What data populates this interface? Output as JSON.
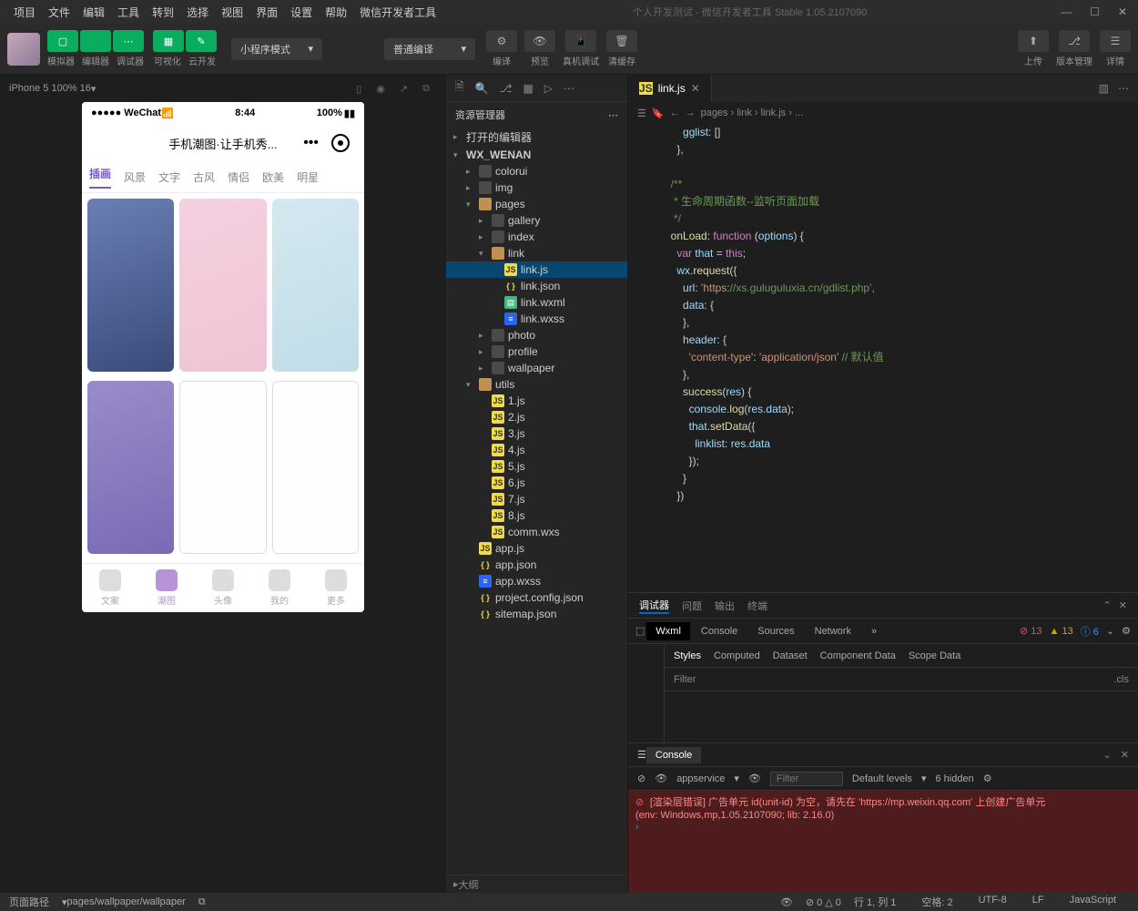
{
  "menubar": [
    "项目",
    "文件",
    "编辑",
    "工具",
    "转到",
    "选择",
    "视图",
    "界面",
    "设置",
    "帮助",
    "微信开发者工具"
  ],
  "title": "个人开发测试 - 微信开发者工具 Stable 1.05.2107090",
  "toolbar": {
    "groups": [
      {
        "icons": [
          "▢",
          "</>",
          "⋯"
        ],
        "labels": [
          "模拟器",
          "编辑器",
          "调试器"
        ]
      },
      {
        "icons": [
          "▦",
          "✎"
        ],
        "labels": [
          "可视化",
          "云开发"
        ]
      }
    ],
    "mode_dd": "小程序模式",
    "compile_dd": "普通编译",
    "actions": [
      {
        "icon": "⚙",
        "label": "编译"
      },
      {
        "icon": "👁",
        "label": "预览"
      },
      {
        "icon": "📱",
        "label": "真机调试"
      },
      {
        "icon": "🗑",
        "label": "清缓存"
      }
    ],
    "right": [
      {
        "icon": "⬆",
        "label": "上传"
      },
      {
        "icon": "⎇",
        "label": "版本管理"
      },
      {
        "icon": "☰",
        "label": "详情"
      }
    ]
  },
  "simulator": {
    "device": "iPhone 5 100% 16"
  },
  "phone": {
    "status": {
      "left": "●●●●● WeChat",
      "time": "8:44",
      "right": "100%"
    },
    "nav_title": "手机潮图·让手机秀...",
    "tabs": [
      "插画",
      "风景",
      "文字",
      "古风",
      "情侣",
      "欧美",
      "明星"
    ],
    "active_tab": 0,
    "tabbar": [
      "文案",
      "潮图",
      "头像",
      "我的",
      "更多"
    ],
    "tabbar_active": 1
  },
  "explorer": {
    "title": "资源管理器",
    "sections": [
      "打开的编辑器",
      "WX_WENAN"
    ],
    "tree": [
      {
        "n": "colorui",
        "t": "folder",
        "d": 1
      },
      {
        "n": "img",
        "t": "folder",
        "d": 1
      },
      {
        "n": "pages",
        "t": "folder-open",
        "d": 1,
        "open": true
      },
      {
        "n": "gallery",
        "t": "folder",
        "d": 2
      },
      {
        "n": "index",
        "t": "folder",
        "d": 2
      },
      {
        "n": "link",
        "t": "folder-open",
        "d": 2,
        "open": true
      },
      {
        "n": "link.js",
        "t": "js",
        "d": 3,
        "sel": true
      },
      {
        "n": "link.json",
        "t": "json",
        "d": 3
      },
      {
        "n": "link.wxml",
        "t": "wxml",
        "d": 3
      },
      {
        "n": "link.wxss",
        "t": "wxss",
        "d": 3
      },
      {
        "n": "photo",
        "t": "folder",
        "d": 2
      },
      {
        "n": "profile",
        "t": "folder",
        "d": 2
      },
      {
        "n": "wallpaper",
        "t": "folder",
        "d": 2
      },
      {
        "n": "utils",
        "t": "folder-open",
        "d": 1,
        "open": true
      },
      {
        "n": "1.js",
        "t": "js",
        "d": 2
      },
      {
        "n": "2.js",
        "t": "js",
        "d": 2
      },
      {
        "n": "3.js",
        "t": "js",
        "d": 2
      },
      {
        "n": "4.js",
        "t": "js",
        "d": 2
      },
      {
        "n": "5.js",
        "t": "js",
        "d": 2
      },
      {
        "n": "6.js",
        "t": "js",
        "d": 2
      },
      {
        "n": "7.js",
        "t": "js",
        "d": 2
      },
      {
        "n": "8.js",
        "t": "js",
        "d": 2
      },
      {
        "n": "comm.wxs",
        "t": "js",
        "d": 2
      },
      {
        "n": "app.js",
        "t": "js",
        "d": 1
      },
      {
        "n": "app.json",
        "t": "json",
        "d": 1
      },
      {
        "n": "app.wxss",
        "t": "wxss",
        "d": 1
      },
      {
        "n": "project.config.json",
        "t": "json",
        "d": 1
      },
      {
        "n": "sitemap.json",
        "t": "json",
        "d": 1
      }
    ],
    "outline": "大纲"
  },
  "editor": {
    "tab": "link.js",
    "breadcrumb": [
      "pages",
      "link",
      "link.js",
      "..."
    ],
    "code_lines": [
      "      gglist: []",
      "    },",
      "",
      "  /**",
      "   * 生命周期函数--监听页面加载",
      "   */",
      "  onLoad: function (options) {",
      "    var that = this;",
      "    wx.request({",
      "      url: 'https://xs.guluguluxia.cn/gdlist.php',",
      "      data: {",
      "      },",
      "      header: {",
      "        'content-type': 'application/json' // 默认值",
      "      },",
      "      success(res) {",
      "        console.log(res.data);",
      "        that.setData({",
      "          linklist: res.data",
      "        });",
      "      }",
      "    })"
    ]
  },
  "devtools": {
    "tabs1": [
      "调试器",
      "问题",
      "输出",
      "终端"
    ],
    "tabs2": [
      "Wxml",
      "Console",
      "Sources",
      "Network"
    ],
    "counts": {
      "err": "13",
      "warn": "13",
      "info": "6"
    },
    "styles_tabs": [
      "Styles",
      "Computed",
      "Dataset",
      "Component Data",
      "Scope Data"
    ],
    "filter": "Filter",
    "cls": ".cls",
    "console_label": "Console",
    "console_ctx": "appservice",
    "console_filter": "Filter",
    "console_levels": "Default levels",
    "console_hidden": "6 hidden",
    "console_error": "[渲染层错误] 广告单元 id(unit-id) 为空，请先在 'https://mp.weixin.qq.com' 上创建广告单元",
    "console_env": "(env: Windows,mp,1.05.2107090; lib: 2.16.0)"
  },
  "statusbar": {
    "left": [
      "页面路径",
      "pages/wallpaper/wallpaper"
    ],
    "mid": [
      "⊘ 0 △ 0"
    ],
    "right": [
      "行 1, 列 1",
      "空格: 2",
      "UTF-8",
      "LF",
      "JavaScript"
    ]
  }
}
